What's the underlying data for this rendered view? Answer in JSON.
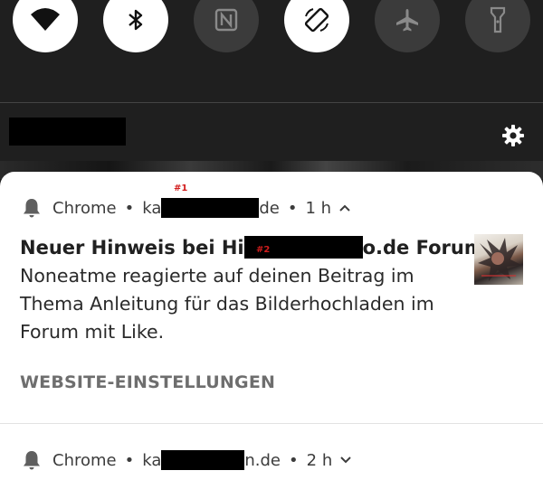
{
  "quick_settings": {
    "tiles": [
      {
        "icon": "wifi-icon",
        "state": "on"
      },
      {
        "icon": "bluetooth-icon",
        "state": "on"
      },
      {
        "icon": "nfc-icon",
        "state": "off"
      },
      {
        "icon": "auto-rotate-icon",
        "state": "on"
      },
      {
        "icon": "airplane-mode-icon",
        "state": "off"
      },
      {
        "icon": "flashlight-icon",
        "state": "off"
      }
    ]
  },
  "notifications": [
    {
      "app_name": "Chrome",
      "site_prefix": "ka",
      "site_suffix": "de",
      "time": "1 h",
      "expanded": true,
      "marker": "#1",
      "title_prefix": "Neuer Hinweis bei Hi",
      "title_suffix": "o.de Forum",
      "title_marker": "#2",
      "body": "Noneatme reagierte auf deinen Beitrag im Thema Anleitung für das Bilderhochladen im Forum mit Like.",
      "action": "WEBSITE-EINSTELLUNGEN"
    },
    {
      "app_name": "Chrome",
      "site_prefix": "ka",
      "site_suffix": "n.de",
      "time": "2 h",
      "expanded": false
    }
  ],
  "colors": {
    "shade_background": "#1f1f1f",
    "tile_on": "#ffffff",
    "tile_off": "#3b3b3b",
    "card_background": "#ffffff",
    "marker": "#d21d1d"
  }
}
